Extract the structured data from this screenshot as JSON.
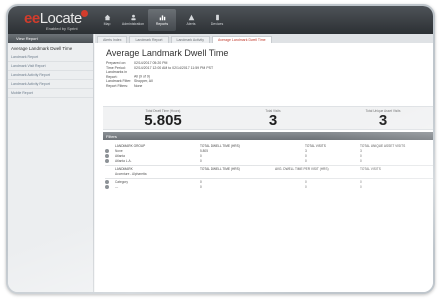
{
  "app": {
    "brand_prefix": "ee",
    "brand_name": "Locate",
    "byline": "Enabled by Sprint"
  },
  "nav": [
    {
      "label": "Map",
      "icon": "home-icon"
    },
    {
      "label": "Administration",
      "icon": "person-icon"
    },
    {
      "label": "Reports",
      "icon": "report-icon"
    },
    {
      "label": "Alerts",
      "icon": "alert-icon"
    },
    {
      "label": "Devices",
      "icon": "device-icon"
    }
  ],
  "sidebar": {
    "header": "View Report",
    "title": "Average Landmark Dwell Time",
    "items": [
      "Landmark Report",
      "Landmark Visit Report",
      "Landmark Activity Report",
      "Landmark Activity Report",
      "Mobile Report"
    ]
  },
  "tabs": [
    "Alerts Index",
    "Landmark Report",
    "Landmark Activity",
    "Average Landmark Dwell Time"
  ],
  "report": {
    "title": "Average Landmark Dwell Time",
    "meta": [
      {
        "k": "Prepared on:",
        "v": "02/14/2017 05:20 PM"
      },
      {
        "k": "Time Period:",
        "v": "02/14/2017 12:00 AM to 02/14/2017 11:59 PM PST"
      },
      {
        "k": "Landmarks in Report:",
        "v": "All (9 of 9)"
      },
      {
        "k": "Landmark Filter:",
        "v": "Shopper, All"
      },
      {
        "k": "Report Filters:",
        "v": "None"
      }
    ],
    "stats": [
      {
        "label": "Total Dwell Time (Hours)",
        "value": "5.805"
      },
      {
        "label": "Total Visits",
        "value": "3"
      },
      {
        "label": "Total Unique Asset Visits",
        "value": "3"
      }
    ],
    "section": "Filters"
  },
  "table1": {
    "headers": [
      "Landmark Group",
      "Total Dwell Time (hrs)",
      "Total Visits",
      "Total Unique Asset Visits"
    ],
    "rows": [
      {
        "name": "None",
        "c1": "5.805",
        "c2": "3",
        "c3": "3"
      },
      {
        "name": "Atlanta",
        "c1": "0",
        "c2": "0",
        "c3": "0"
      },
      {
        "name": "Atlanta L.A.",
        "c1": "0",
        "c2": "0",
        "c3": "0"
      }
    ]
  },
  "table2": {
    "headers": [
      "Landmark",
      "Total Dwell Time (hrs)",
      "Avg. Dwell Time per Visit (hrs)",
      "Total Visits"
    ],
    "sub": "Accenture - Alpharetta",
    "rows": [
      {
        "name": "Category",
        "c1": "0",
        "c2": "0",
        "c3": "0"
      },
      {
        "name": "---",
        "c1": "0",
        "c2": "0",
        "c3": "0"
      }
    ]
  }
}
